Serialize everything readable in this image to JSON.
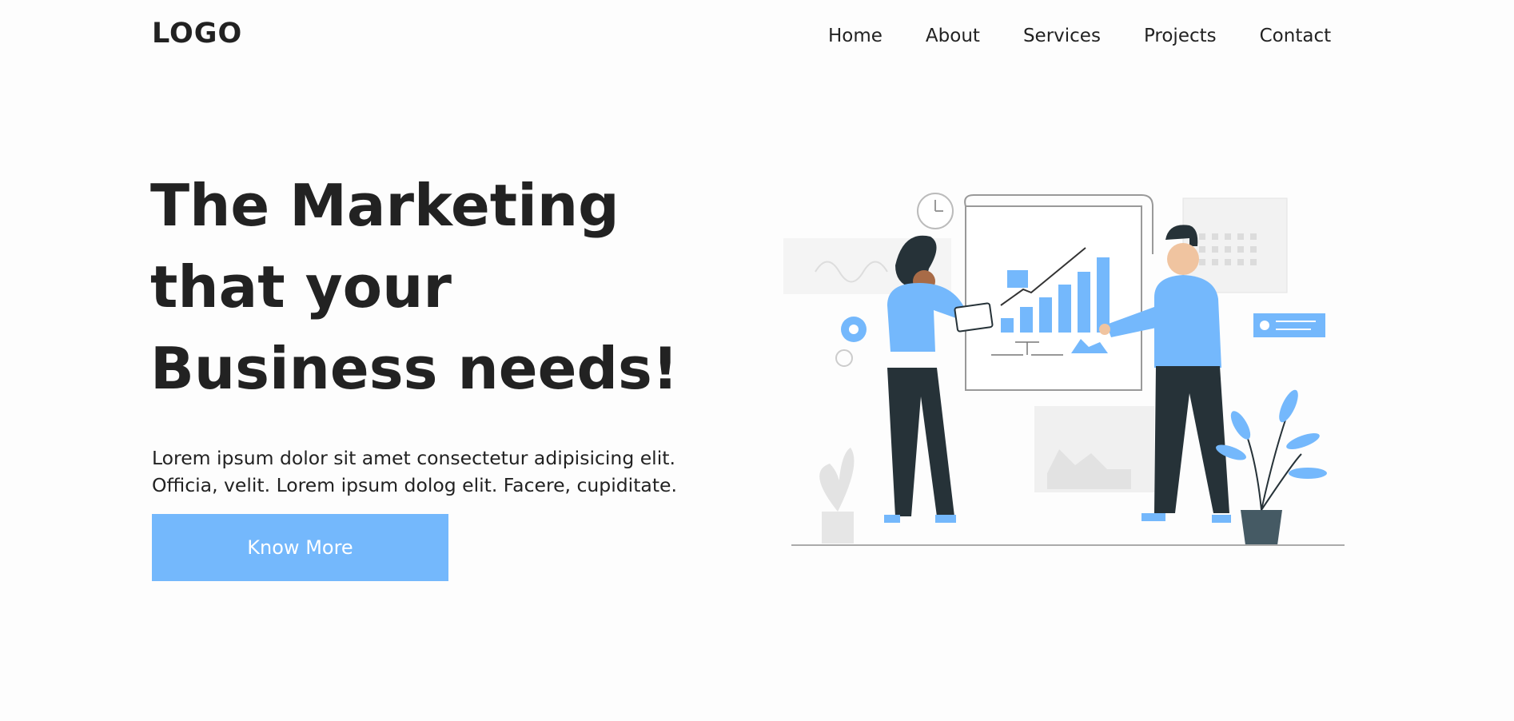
{
  "header": {
    "logo": "LOGO",
    "nav": [
      "Home",
      "About",
      "Services",
      "Projects",
      "Contact"
    ]
  },
  "hero": {
    "title": "The Marketing that your Business needs!",
    "description": "Lorem ipsum dolor sit amet consectetur adipisicing elit. Officia, velit. Lorem ipsum dolog elit. Facere, cupiditate.",
    "cta_label": "Know More"
  },
  "illustration": {
    "icon": "business-presentation-illustration",
    "colors": {
      "accent": "#74b8fc",
      "dark": "#263238",
      "gray": "#e6e6e6"
    }
  }
}
